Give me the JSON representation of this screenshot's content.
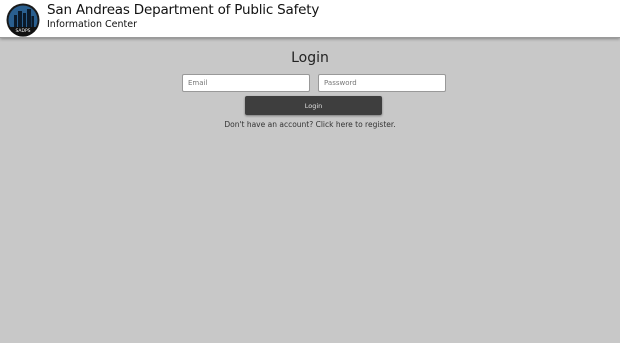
{
  "header": {
    "title": "San Andreas Department of Public Safety",
    "subtitle": "Information Center",
    "logo_icon": "sadps-badge-icon",
    "logo_text": "SADPS"
  },
  "login": {
    "heading": "Login",
    "email_placeholder": "Email",
    "password_placeholder": "Password",
    "submit_label": "Login",
    "register_text": "Don't have an account? Click here to register."
  },
  "colors": {
    "background": "#c8c8c8",
    "header_background": "#ffffff",
    "button_background": "#3e3e3e"
  }
}
